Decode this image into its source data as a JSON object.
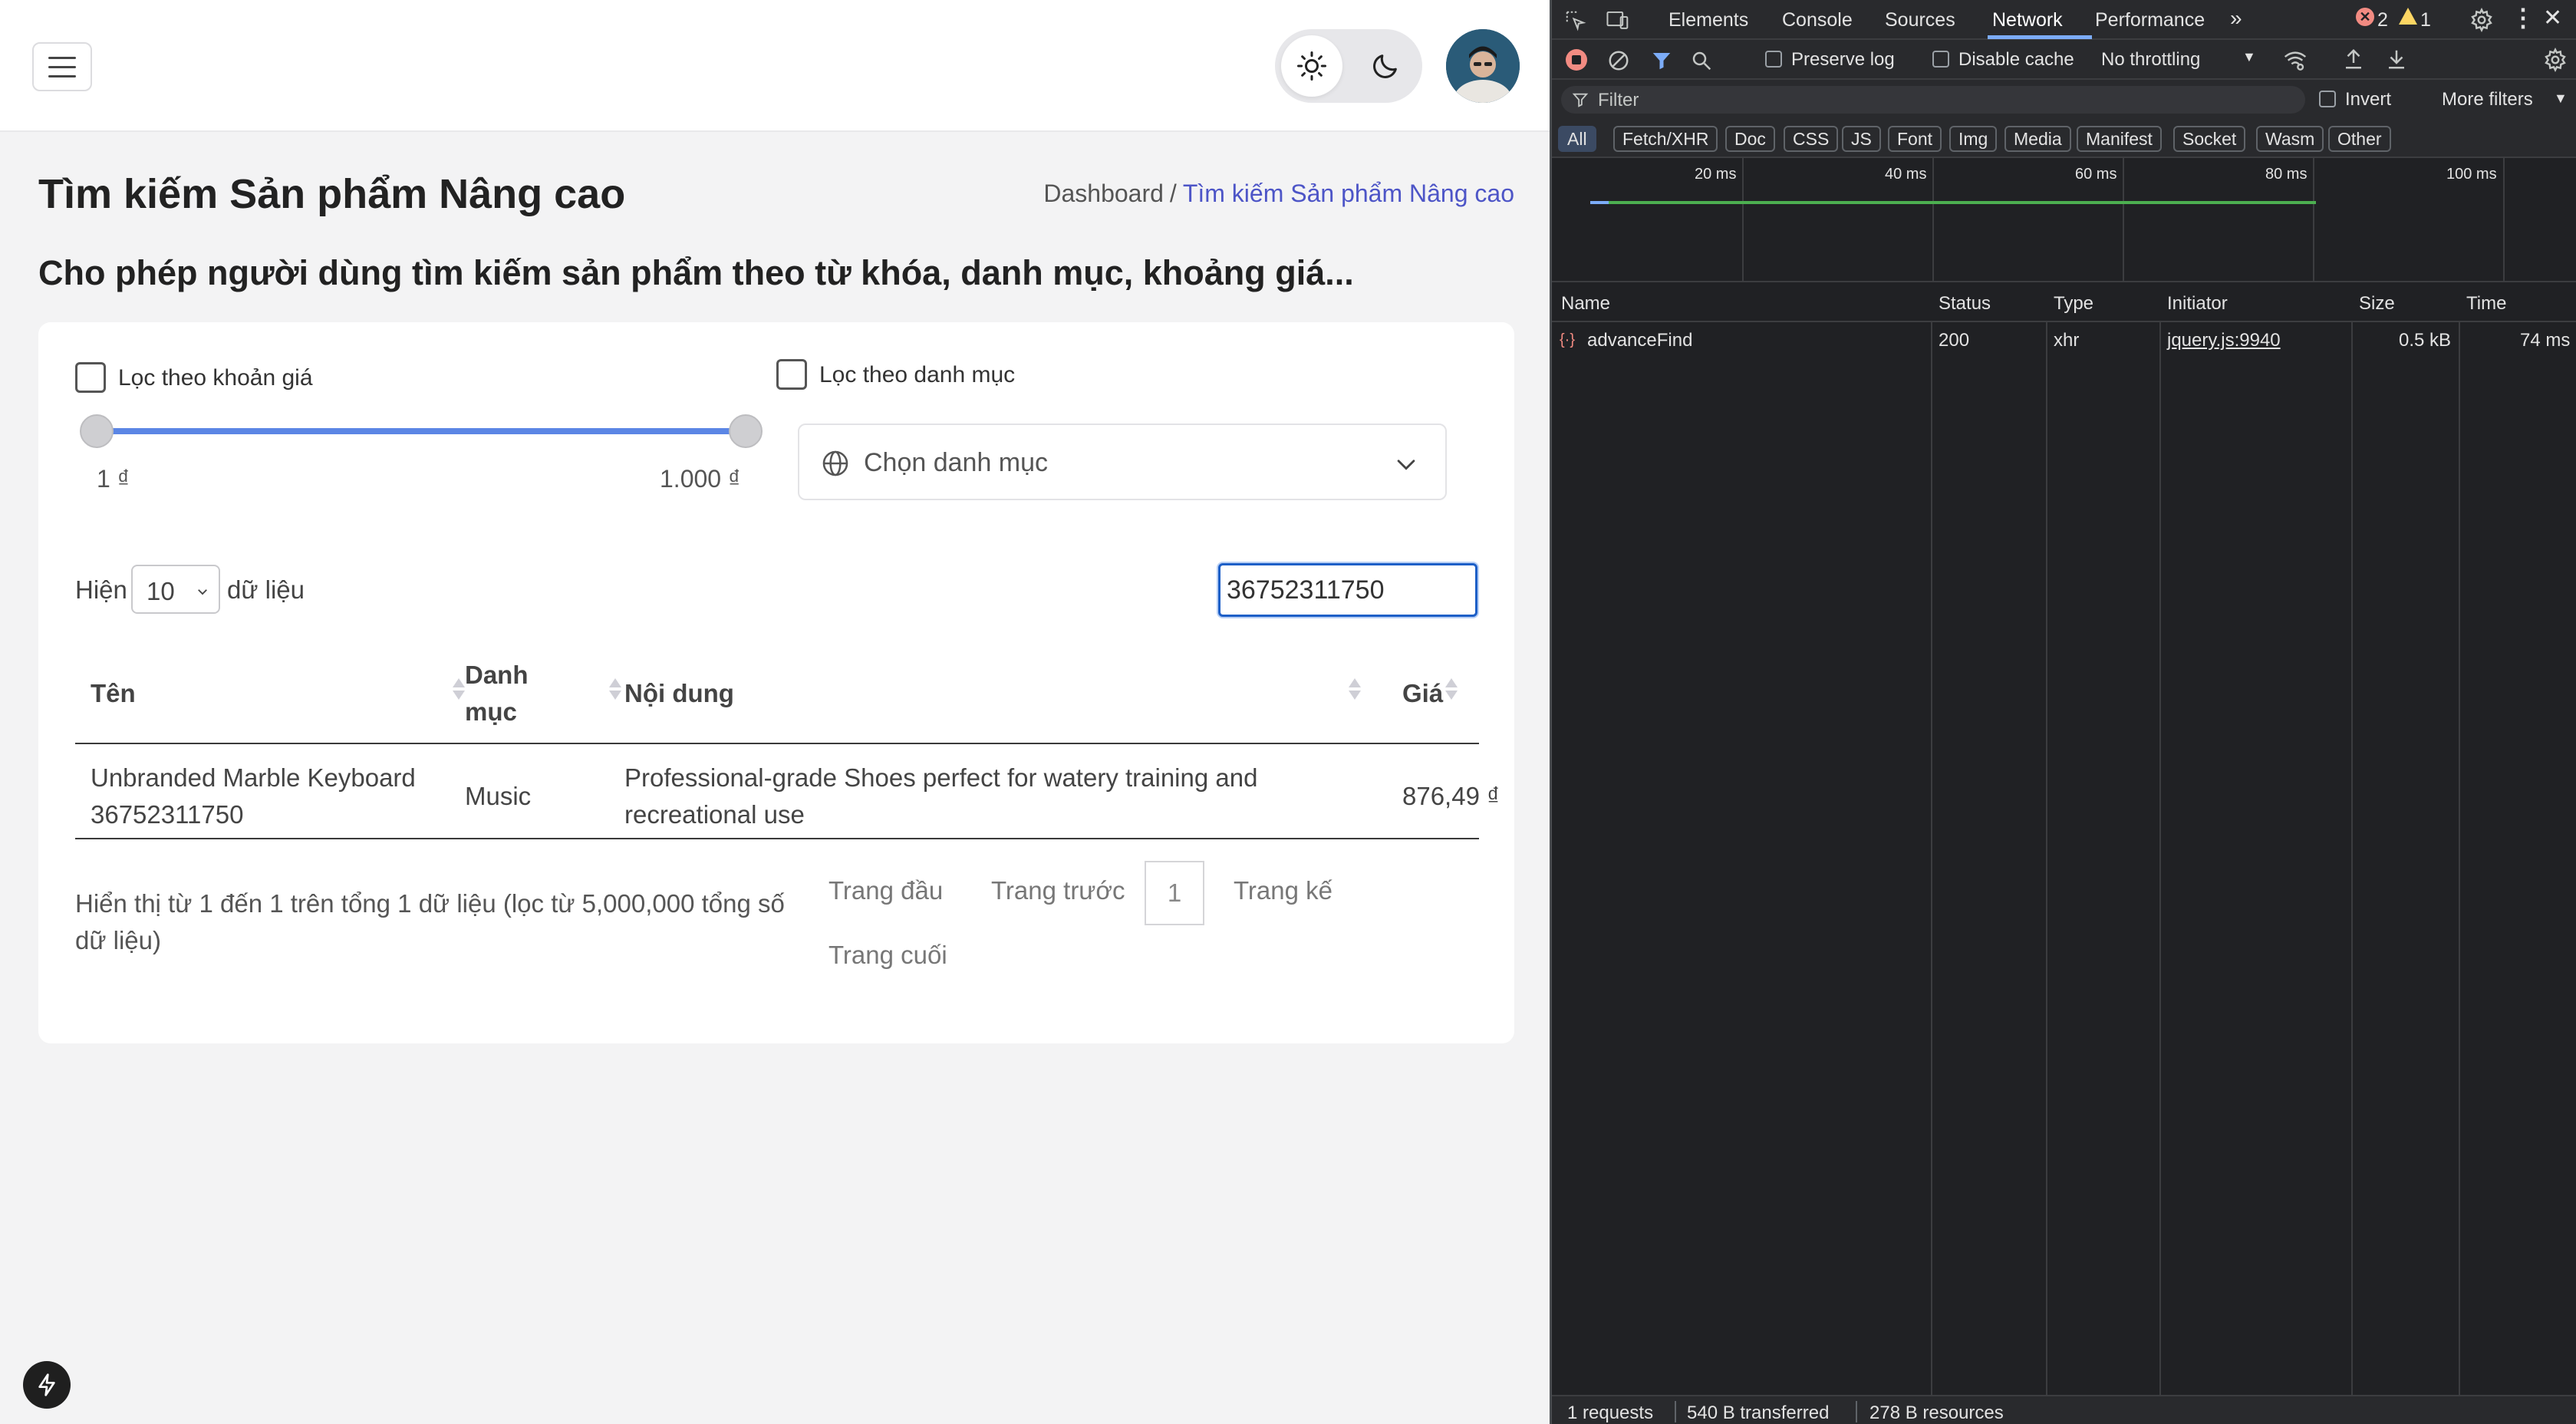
{
  "app": {
    "title": "Tìm kiếm Sản phẩm Nâng cao",
    "subtitle": "Cho phép người dùng tìm kiếm sản phẩm theo từ khóa, danh mục, khoảng giá...",
    "breadcrumb": {
      "home": "Dashboard",
      "separator": "/",
      "current": "Tìm kiếm Sản phẩm Nâng cao"
    },
    "filters": {
      "price_label": "Lọc theo khoản giá",
      "price_checked": false,
      "category_label": "Lọc theo danh mục",
      "category_checked": false,
      "price_min_label": "1 ₫",
      "price_max_label": "1.000 ₫",
      "slider_low_fraction": 0,
      "slider_high_fraction": 1,
      "category_placeholder": "Chọn danh mục"
    },
    "length": {
      "prefix": "Hiện",
      "value": "10",
      "suffix": "dữ liệu"
    },
    "search": {
      "value": "36752311750"
    },
    "table": {
      "headers": [
        "Tên",
        "Danh\nmục",
        "Nội dung",
        "Giá"
      ],
      "rows": [
        {
          "name": "Unbranded Marble Keyboard 36752311750",
          "category": "Music",
          "content": "Professional-grade Shoes perfect for watery training and recreational use",
          "price": "876,49 ₫"
        }
      ]
    },
    "info": "Hiển thị từ 1 đến 1 trên tổng 1 dữ liệu (lọc từ 5,000,000 tổng số dữ liệu)",
    "pagination": {
      "first": "Trang đầu",
      "prev": "Trang trước",
      "current": "1",
      "next": "Trang kế",
      "last": "Trang cuối"
    },
    "colors": {
      "accent": "#4d55c7",
      "slider": "#5b86e5",
      "focus": "#1d5fc7"
    }
  },
  "devtools": {
    "tabs": [
      "Elements",
      "Console",
      "Sources",
      "Network",
      "Performance"
    ],
    "active_tab": "Network",
    "errors": "2",
    "warnings": "1",
    "toolbar": {
      "preserve_log": "Preserve log",
      "disable_cache": "Disable cache",
      "throttling": "No throttling"
    },
    "filter": {
      "placeholder": "Filter",
      "invert": "Invert",
      "more_filters": "More filters"
    },
    "types": [
      "All",
      "Fetch/XHR",
      "Doc",
      "CSS",
      "JS",
      "Font",
      "Img",
      "Media",
      "Manifest",
      "Socket",
      "Wasm",
      "Other"
    ],
    "timeline_ticks": [
      "20 ms",
      "40 ms",
      "60 ms",
      "80 ms",
      "100 ms"
    ],
    "columns": [
      "Name",
      "Status",
      "Type",
      "Initiator",
      "Size",
      "Time"
    ],
    "requests": [
      {
        "name": "advanceFind",
        "status": "200",
        "type": "xhr",
        "initiator": "jquery.js:9940",
        "size": "0.5 kB",
        "time": "74 ms"
      }
    ],
    "status_bar": {
      "requests": "1 requests",
      "transferred": "540 B transferred",
      "resources": "278 B resources"
    },
    "colors": {
      "bg": "#202124",
      "link": "#7cacf8",
      "ok_bar": "#4caf50",
      "error": "#f28b82",
      "warning": "#fdd663"
    }
  }
}
